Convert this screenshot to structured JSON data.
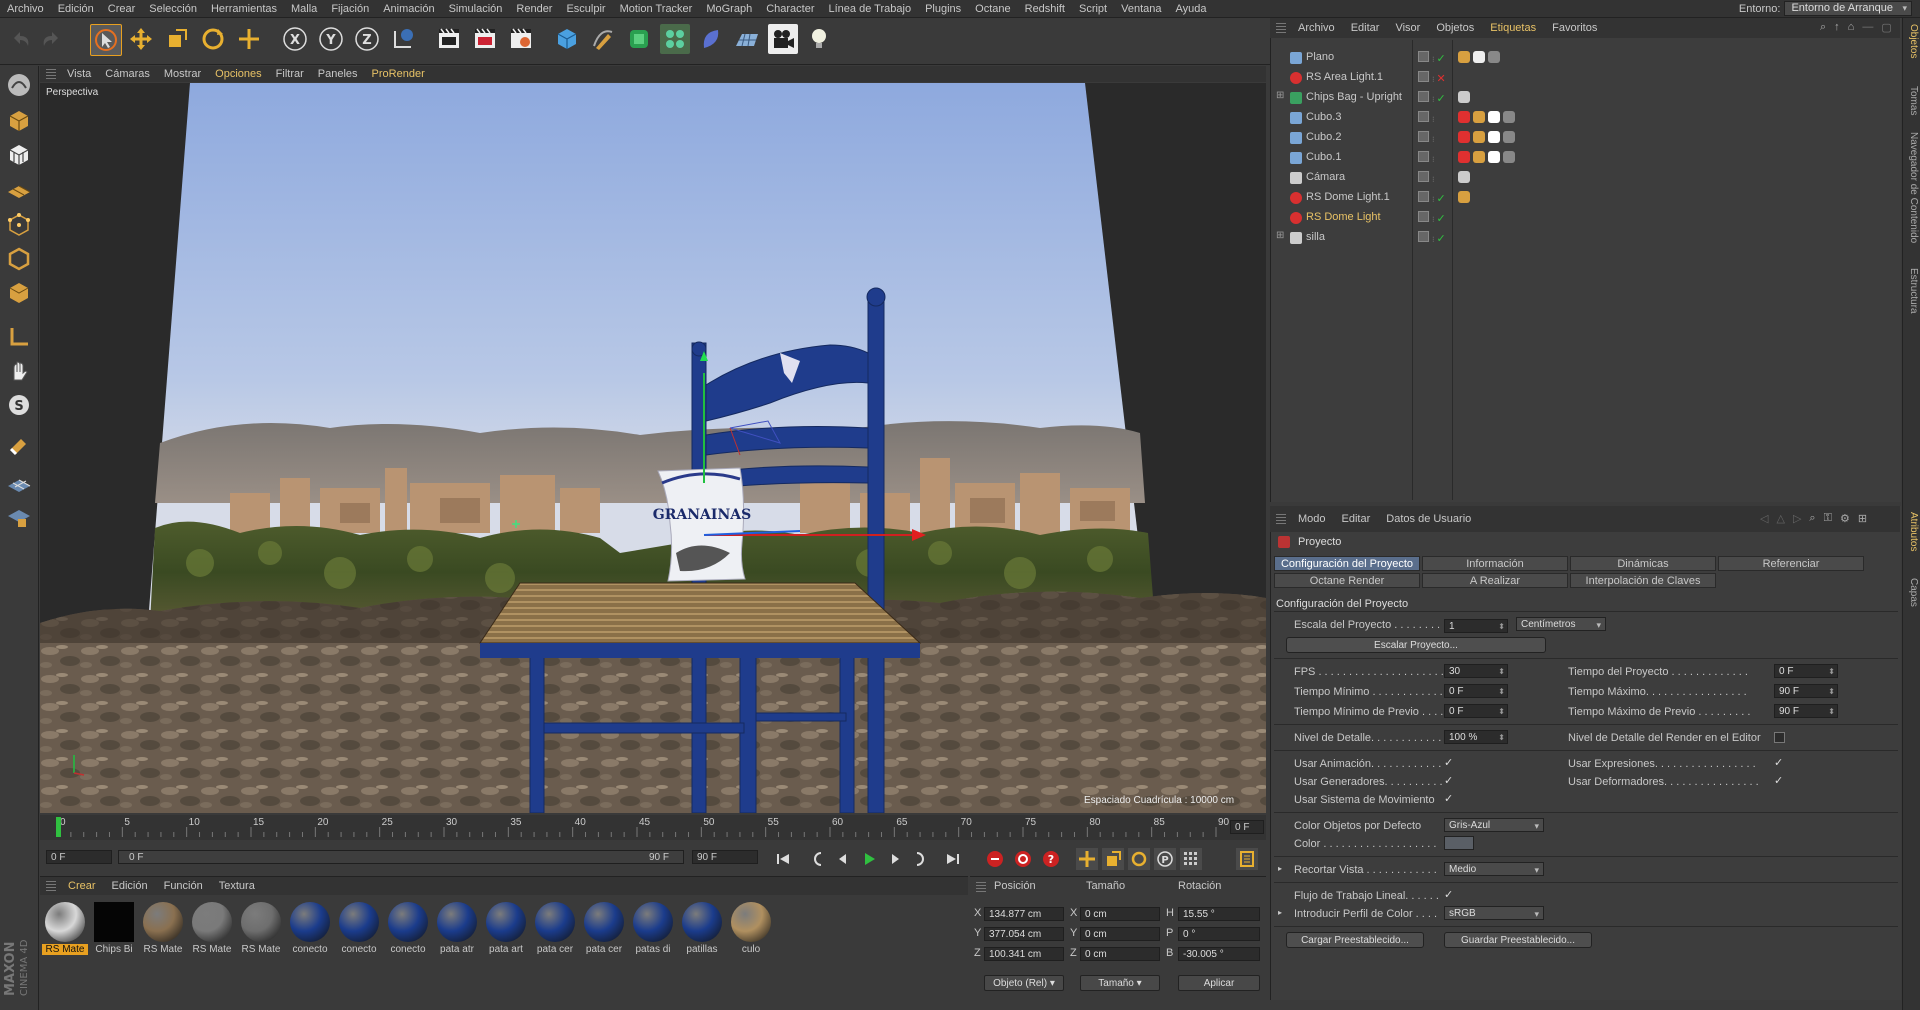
{
  "menubar": {
    "items": [
      {
        "label": "Archivo",
        "hl": false
      },
      {
        "label": "Edición",
        "hl": false
      },
      {
        "label": "Crear",
        "hl": false
      },
      {
        "label": "Selección",
        "hl": false
      },
      {
        "label": "Herramientas",
        "hl": false
      },
      {
        "label": "Malla",
        "hl": false
      },
      {
        "label": "Fijación",
        "hl": false
      },
      {
        "label": "Animación",
        "hl": false
      },
      {
        "label": "Simulación",
        "hl": false
      },
      {
        "label": "Render",
        "hl": false
      },
      {
        "label": "Esculpir",
        "hl": false
      },
      {
        "label": "Motion Tracker",
        "hl": false
      },
      {
        "label": "MoGraph",
        "hl": false
      },
      {
        "label": "Character",
        "hl": false
      },
      {
        "label": "Línea de Trabajo",
        "hl": false
      },
      {
        "label": "Plugins",
        "hl": false
      },
      {
        "label": "Octane",
        "hl": false
      },
      {
        "label": "Redshift",
        "hl": false
      },
      {
        "label": "Script",
        "hl": false
      },
      {
        "label": "Ventana",
        "hl": false
      },
      {
        "label": "Ayuda",
        "hl": false
      }
    ],
    "env_label": "Entorno:",
    "env_value": "Entorno de Arranque"
  },
  "viewport": {
    "menu": [
      "Vista",
      "Cámaras",
      "Mostrar",
      "Opciones",
      "Filtrar",
      "Paneles",
      "ProRender"
    ],
    "label": "Perspectiva",
    "grid_spacing": "Espaciado Cuadrícula : 10000 cm",
    "bag_text": "GRANAINAS"
  },
  "timeline": {
    "ticks": [
      "0",
      "5",
      "10",
      "15",
      "20",
      "25",
      "30",
      "35",
      "40",
      "45",
      "50",
      "55",
      "60",
      "65",
      "70",
      "75",
      "80",
      "85",
      "90"
    ],
    "current": "0 F",
    "start": "0 F",
    "range_start": "0 F",
    "range_end": "90 F",
    "end": "90 F"
  },
  "materials": {
    "menu": [
      "Crear",
      "Edición",
      "Función",
      "Textura"
    ],
    "items": [
      {
        "label": "RS Mate",
        "color": "#d8d8d8",
        "selected": true
      },
      {
        "label": "Chips Bi",
        "color": "#050505",
        "selected": false
      },
      {
        "label": "RS Mate",
        "color": "#8a7050",
        "selected": false
      },
      {
        "label": "RS Mate",
        "color": "#7a7a7a",
        "selected": false
      },
      {
        "label": "RS Mate",
        "color": "#6e6e6e",
        "selected": false
      },
      {
        "label": "conecto",
        "color": "#1b3c8c",
        "selected": false
      },
      {
        "label": "conecto",
        "color": "#1b3c8c",
        "selected": false
      },
      {
        "label": "conecto",
        "color": "#1b3c8c",
        "selected": false
      },
      {
        "label": "pata atr",
        "color": "#1b3c8c",
        "selected": false
      },
      {
        "label": "pata art",
        "color": "#1b3c8c",
        "selected": false
      },
      {
        "label": "pata cer",
        "color": "#1b3c8c",
        "selected": false
      },
      {
        "label": "pata cer",
        "color": "#1b3c8c",
        "selected": false
      },
      {
        "label": "patas di",
        "color": "#1b3c8c",
        "selected": false
      },
      {
        "label": "patillas",
        "color": "#1b3c8c",
        "selected": false
      },
      {
        "label": "culo",
        "color": "#b09060",
        "selected": false
      }
    ]
  },
  "coords": {
    "headers": [
      "Posición",
      "Tamaño",
      "Rotación"
    ],
    "rows": [
      {
        "axis": "X",
        "pos": "134.877 cm",
        "size_axis": "X",
        "size": "0 cm",
        "rot_axis": "H",
        "rot": "15.55 °"
      },
      {
        "axis": "Y",
        "pos": "377.054 cm",
        "size_axis": "Y",
        "size": "0 cm",
        "rot_axis": "P",
        "rot": "0 °"
      },
      {
        "axis": "Z",
        "pos": "100.341 cm",
        "size_axis": "Z",
        "size": "0 cm",
        "rot_axis": "B",
        "rot": "-30.005 °"
      }
    ],
    "mode": "Objeto (Rel)",
    "size_mode": "Tamaño",
    "apply": "Aplicar"
  },
  "objects": {
    "menu": [
      "Archivo",
      "Editar",
      "Visor",
      "Objetos",
      "Etiquetas",
      "Favoritos"
    ],
    "items": [
      {
        "name": "Plano",
        "icon": "plane-icon",
        "color": "#7aa6d6",
        "hl": false
      },
      {
        "name": "RS Area Light.1",
        "icon": "rs-light-icon",
        "color": "#d83030",
        "hl": false
      },
      {
        "name": "Chips Bag - Upright",
        "icon": "null-group-icon",
        "color": "#3aa060",
        "hl": false
      },
      {
        "name": "Cubo.3",
        "icon": "cube-icon",
        "color": "#7aa6d6",
        "hl": false
      },
      {
        "name": "Cubo.2",
        "icon": "cube-icon",
        "color": "#7aa6d6",
        "hl": false
      },
      {
        "name": "Cubo.1",
        "icon": "cube-icon",
        "color": "#7aa6d6",
        "hl": false
      },
      {
        "name": "Cámara",
        "icon": "camera-icon",
        "color": "#cccccc",
        "hl": false
      },
      {
        "name": "RS Dome Light.1",
        "icon": "rs-light-icon",
        "color": "#d83030",
        "hl": false
      },
      {
        "name": "RS Dome Light",
        "icon": "rs-light-icon",
        "color": "#d83030",
        "hl": true
      },
      {
        "name": "silla",
        "icon": "null-object-icon",
        "color": "#cccccc",
        "hl": false
      }
    ]
  },
  "attributes": {
    "menu": [
      "Modo",
      "Editar",
      "Datos de Usuario"
    ],
    "title": "Proyecto",
    "tabs_row1": [
      "Configuración del Proyecto",
      "Información",
      "Dinámicas",
      "Referenciar"
    ],
    "tabs_row2": [
      "Octane Render",
      "A Realizar",
      "Interpolación de Claves"
    ],
    "section": "Configuración del Proyecto",
    "escala_label": "Escala del Proyecto . . . . . . . .",
    "escala_value": "1",
    "escala_unit": "Centímetros",
    "escalar_btn": "Escalar Proyecto...",
    "fps_label": "FPS . . . . . . . . . . . . . . . . . . . . .",
    "fps_value": "30",
    "tproj_label": "Tiempo del Proyecto . . . . . . . . . . . . .",
    "tproj_value": "0 F",
    "tmin_label": "Tiempo Mínimo . . . . . . . . . . . . .",
    "tmin_value": "0 F",
    "tmax_label": "Tiempo Máximo. . . . . . . . . . . . . . . . .",
    "tmax_value": "90 F",
    "tminp_label": "Tiempo Mínimo de Previo . . . .",
    "tminp_value": "0 F",
    "tmaxp_label": "Tiempo Máximo de Previo . . . . . . . . .",
    "tmaxp_value": "90 F",
    "detalle_label": "Nivel de Detalle. . . . . . . . . . . .",
    "detalle_value": "100 %",
    "detalle_render_label": "Nivel de Detalle del Render en el Editor",
    "usar_anim": "Usar Animación. . . . . . . . . . . .",
    "usar_expr": "Usar Expresiones. . . . . . . . . . . . . . . . .",
    "usar_gen": "Usar Generadores. . . . . . . . . .",
    "usar_def": "Usar Deformadores. . . . . . . . . . . . . . . .",
    "usar_mov": "Usar Sistema de Movimiento",
    "color_obj_label": "Color Objetos por Defecto",
    "color_obj_value": "Gris-Azul",
    "color_label": "Color . . . . . . . . . . . . . . . . . . .",
    "recortar_label": "Recortar Vista . . . . . . . . . . . .",
    "recortar_value": "Medio",
    "flujo_label": "Flujo de Trabajo Lineal. . . . . .",
    "perfil_label": "Introducir Perfil de Color . . . .",
    "perfil_value": "sRGB",
    "cargar_btn": "Cargar Preestablecido...",
    "guardar_btn": "Guardar Preestablecido..."
  },
  "vtabs": [
    "Objetos",
    "Tomas",
    "Navegador de Contenido",
    "Estructura",
    "Atributos",
    "Capas"
  ]
}
